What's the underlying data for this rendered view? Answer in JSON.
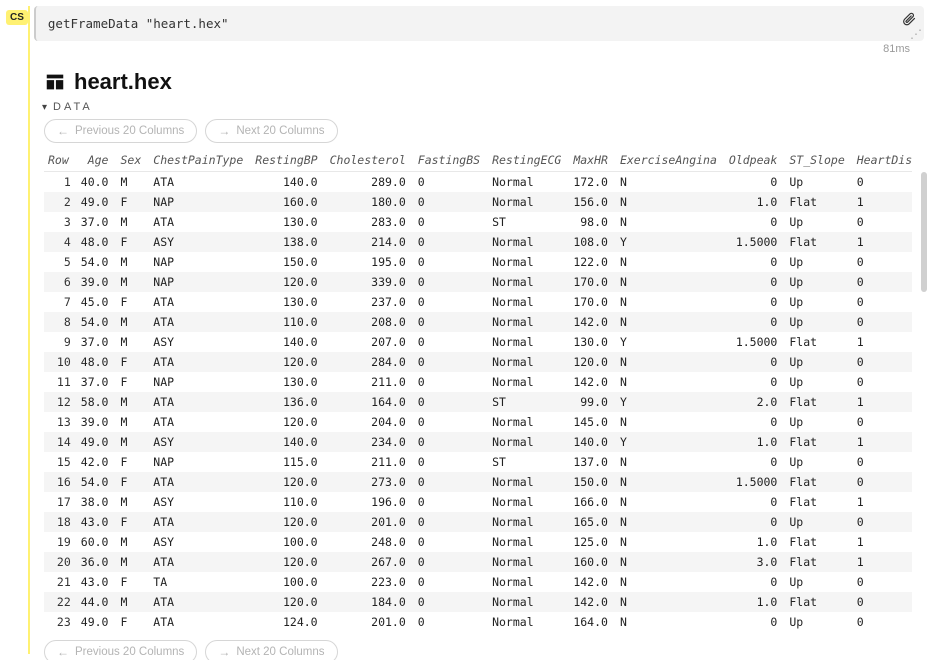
{
  "cell": {
    "type_label": "CS",
    "code": "getFrameData \"heart.hex\"",
    "timing": "81ms",
    "attach_icon": "attach-icon"
  },
  "output": {
    "title": "heart.hex",
    "data_label": "DATA",
    "prev_label": "Previous 20 Columns",
    "next_label": "Next 20 Columns",
    "columns": [
      "Row",
      "Age",
      "Sex",
      "ChestPainType",
      "RestingBP",
      "Cholesterol",
      "FastingBS",
      "RestingECG",
      "MaxHR",
      "ExerciseAngina",
      "Oldpeak",
      "ST_Slope",
      "HeartDisease"
    ],
    "col_align": [
      "n",
      "n",
      "l",
      "l",
      "n",
      "n",
      "l",
      "l",
      "n",
      "l",
      "n",
      "l",
      "l"
    ],
    "rows": [
      [
        "1",
        "40.0",
        "M",
        "ATA",
        "140.0",
        "289.0",
        "0",
        "Normal",
        "172.0",
        "N",
        "0",
        "Up",
        "0"
      ],
      [
        "2",
        "49.0",
        "F",
        "NAP",
        "160.0",
        "180.0",
        "0",
        "Normal",
        "156.0",
        "N",
        "1.0",
        "Flat",
        "1"
      ],
      [
        "3",
        "37.0",
        "M",
        "ATA",
        "130.0",
        "283.0",
        "0",
        "ST",
        "98.0",
        "N",
        "0",
        "Up",
        "0"
      ],
      [
        "4",
        "48.0",
        "F",
        "ASY",
        "138.0",
        "214.0",
        "0",
        "Normal",
        "108.0",
        "Y",
        "1.5000",
        "Flat",
        "1"
      ],
      [
        "5",
        "54.0",
        "M",
        "NAP",
        "150.0",
        "195.0",
        "0",
        "Normal",
        "122.0",
        "N",
        "0",
        "Up",
        "0"
      ],
      [
        "6",
        "39.0",
        "M",
        "NAP",
        "120.0",
        "339.0",
        "0",
        "Normal",
        "170.0",
        "N",
        "0",
        "Up",
        "0"
      ],
      [
        "7",
        "45.0",
        "F",
        "ATA",
        "130.0",
        "237.0",
        "0",
        "Normal",
        "170.0",
        "N",
        "0",
        "Up",
        "0"
      ],
      [
        "8",
        "54.0",
        "M",
        "ATA",
        "110.0",
        "208.0",
        "0",
        "Normal",
        "142.0",
        "N",
        "0",
        "Up",
        "0"
      ],
      [
        "9",
        "37.0",
        "M",
        "ASY",
        "140.0",
        "207.0",
        "0",
        "Normal",
        "130.0",
        "Y",
        "1.5000",
        "Flat",
        "1"
      ],
      [
        "10",
        "48.0",
        "F",
        "ATA",
        "120.0",
        "284.0",
        "0",
        "Normal",
        "120.0",
        "N",
        "0",
        "Up",
        "0"
      ],
      [
        "11",
        "37.0",
        "F",
        "NAP",
        "130.0",
        "211.0",
        "0",
        "Normal",
        "142.0",
        "N",
        "0",
        "Up",
        "0"
      ],
      [
        "12",
        "58.0",
        "M",
        "ATA",
        "136.0",
        "164.0",
        "0",
        "ST",
        "99.0",
        "Y",
        "2.0",
        "Flat",
        "1"
      ],
      [
        "13",
        "39.0",
        "M",
        "ATA",
        "120.0",
        "204.0",
        "0",
        "Normal",
        "145.0",
        "N",
        "0",
        "Up",
        "0"
      ],
      [
        "14",
        "49.0",
        "M",
        "ASY",
        "140.0",
        "234.0",
        "0",
        "Normal",
        "140.0",
        "Y",
        "1.0",
        "Flat",
        "1"
      ],
      [
        "15",
        "42.0",
        "F",
        "NAP",
        "115.0",
        "211.0",
        "0",
        "ST",
        "137.0",
        "N",
        "0",
        "Up",
        "0"
      ],
      [
        "16",
        "54.0",
        "F",
        "ATA",
        "120.0",
        "273.0",
        "0",
        "Normal",
        "150.0",
        "N",
        "1.5000",
        "Flat",
        "0"
      ],
      [
        "17",
        "38.0",
        "M",
        "ASY",
        "110.0",
        "196.0",
        "0",
        "Normal",
        "166.0",
        "N",
        "0",
        "Flat",
        "1"
      ],
      [
        "18",
        "43.0",
        "F",
        "ATA",
        "120.0",
        "201.0",
        "0",
        "Normal",
        "165.0",
        "N",
        "0",
        "Up",
        "0"
      ],
      [
        "19",
        "60.0",
        "M",
        "ASY",
        "100.0",
        "248.0",
        "0",
        "Normal",
        "125.0",
        "N",
        "1.0",
        "Flat",
        "1"
      ],
      [
        "20",
        "36.0",
        "M",
        "ATA",
        "120.0",
        "267.0",
        "0",
        "Normal",
        "160.0",
        "N",
        "3.0",
        "Flat",
        "1"
      ],
      [
        "21",
        "43.0",
        "F",
        "TA",
        "100.0",
        "223.0",
        "0",
        "Normal",
        "142.0",
        "N",
        "0",
        "Up",
        "0"
      ],
      [
        "22",
        "44.0",
        "M",
        "ATA",
        "120.0",
        "184.0",
        "0",
        "Normal",
        "142.0",
        "N",
        "1.0",
        "Flat",
        "0"
      ],
      [
        "23",
        "49.0",
        "F",
        "ATA",
        "124.0",
        "201.0",
        "0",
        "Normal",
        "164.0",
        "N",
        "0",
        "Up",
        "0"
      ]
    ]
  }
}
